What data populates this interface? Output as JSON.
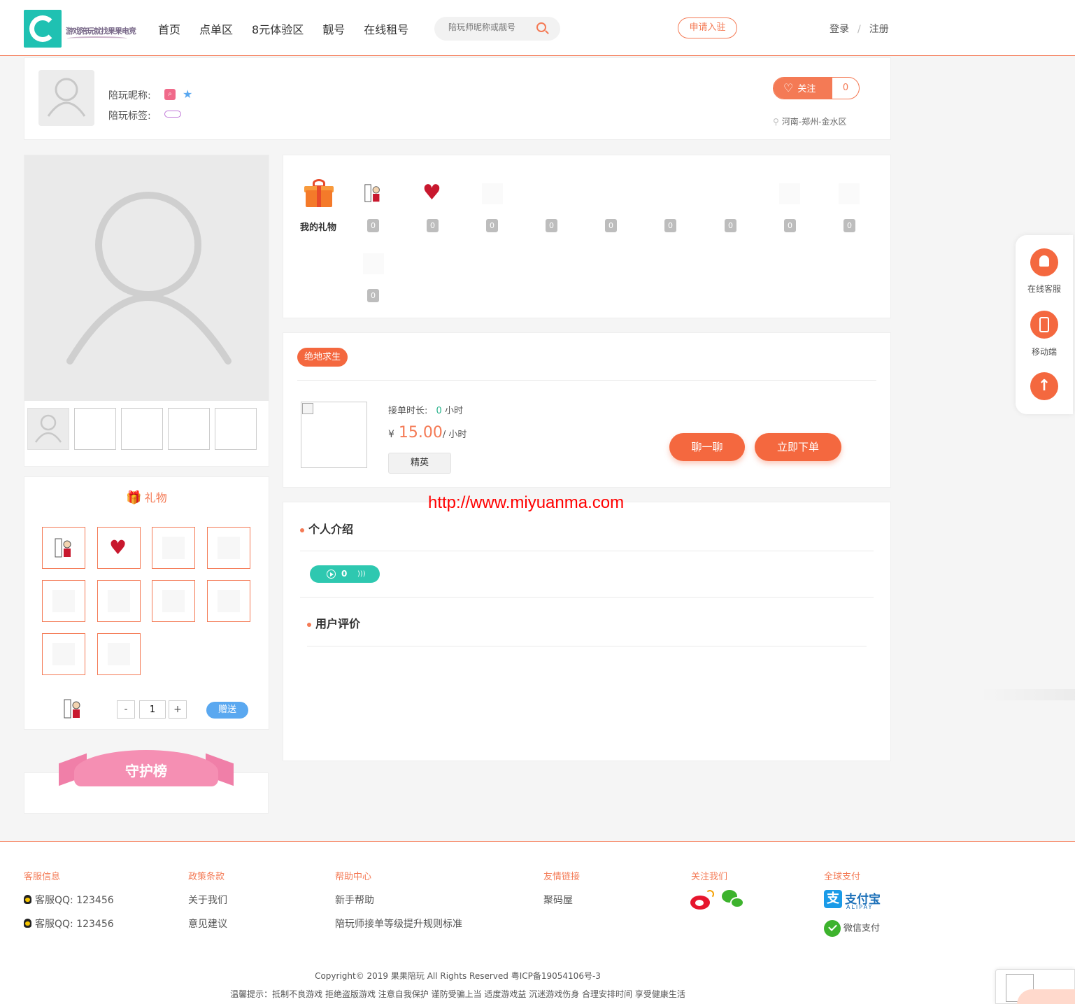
{
  "header": {
    "logo_text": "游戏陪玩就找果果电竞",
    "nav": [
      "首页",
      "点单区",
      "8元体验区",
      "靓号",
      "在线租号"
    ],
    "search_placeholder": "陪玩师昵称或靓号",
    "apply_label": "申请入驻",
    "login_label": "登录",
    "login_sep": "/",
    "register_label": "注册"
  },
  "profile": {
    "nickname_label": "陪玩昵称:",
    "tags_label": "陪玩标签:",
    "follow_label": "关注",
    "follow_count": "0",
    "location": "河南-郑州-金水区"
  },
  "gifts": {
    "title": "礼物",
    "quantity": "1",
    "minus": "-",
    "plus": "+",
    "send_label": "赠送"
  },
  "guard": {
    "title": "守护榜"
  },
  "my_gifts": {
    "label": "我的礼物",
    "counts": [
      "0",
      "0",
      "0",
      "0",
      "0",
      "0",
      "0",
      "0",
      "0",
      "0"
    ]
  },
  "game": {
    "tag": "绝地求生",
    "duration_label": "接单时长:",
    "duration_value": "0",
    "duration_unit": "小时",
    "currency": "¥",
    "price": "15.00",
    "price_unit": "/ 小时",
    "level": "精英",
    "chat_label": "聊一聊",
    "order_label": "立即下单"
  },
  "intro": {
    "title": "个人介绍",
    "voice_count": "0",
    "reviews_title": "用户评价"
  },
  "watermark": "http://www.miyuanma.com",
  "sidebar": {
    "service_label": "在线客服",
    "mobile_label": "移动端",
    "top_arrow": "↑"
  },
  "footer": {
    "service": {
      "title": "客服信息",
      "items": [
        "客服QQ: 123456",
        "客服QQ: 123456"
      ]
    },
    "policy": {
      "title": "政策条款",
      "items": [
        "关于我们",
        "意见建议"
      ]
    },
    "help": {
      "title": "帮助中心",
      "items": [
        "新手帮助",
        "陪玩师接单等级提升规则标准"
      ]
    },
    "links": {
      "title": "友情链接",
      "items": [
        "聚码屋"
      ]
    },
    "follow": {
      "title": "关注我们"
    },
    "pay": {
      "title": "全球支付",
      "alipay": "支付宝",
      "alipay_en": "ALIPAY",
      "wechat_pay": "微信支付"
    },
    "copyright": "Copyright© 2019 果果陪玩 All Rights Reserved 粤ICP备19054106号-3",
    "tips": "温馨提示：抵制不良游戏 拒绝盗版游戏 注意自我保护 谨防受骗上当 适度游戏益 沉迷游戏伤身 合理安排时间 享受健康生活"
  },
  "colors": {
    "accent": "#f47a55",
    "button": "#f4683f",
    "teal": "#2ec8b0",
    "blue": "#5aa8f0"
  }
}
